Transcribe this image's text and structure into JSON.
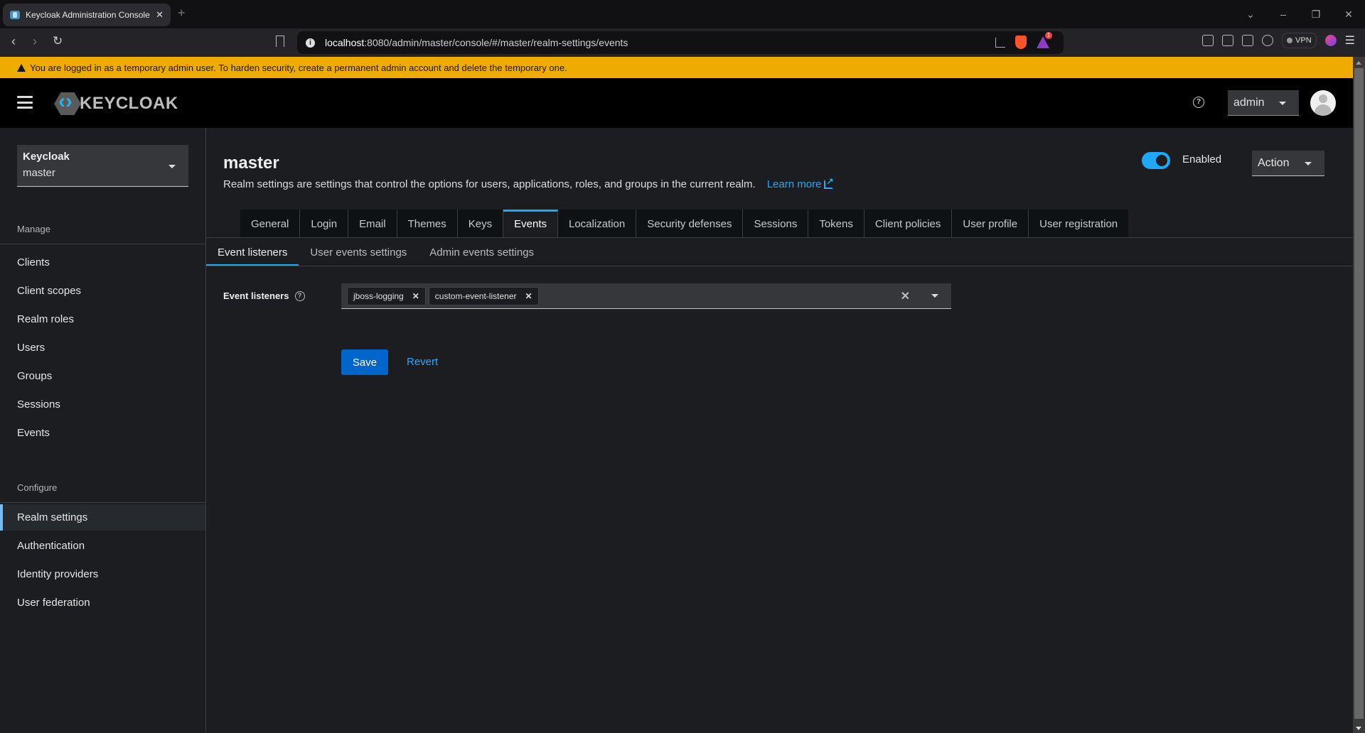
{
  "browser": {
    "tab_title": "Keycloak Administration Console",
    "tab_close": "✕",
    "new_tab": "+",
    "window_controls": [
      "⌄",
      "–",
      "❐",
      "✕"
    ],
    "url_host": "localhost",
    "url_path": ":8080/admin/master/console/#/master/realm-settings/events",
    "rewards_badge": "1",
    "vpn_label": "VPN",
    "nav_back": "‹",
    "nav_forward": "›",
    "nav_reload": "↻",
    "menu": "☰"
  },
  "banner": {
    "text": "You are logged in as a temporary admin user. To harden security, create a permanent admin account and delete the temporary one.",
    "color": "#f0ab00"
  },
  "masthead": {
    "logo_text": "KEYCLOAK",
    "help": "?",
    "user": "admin"
  },
  "sidebar": {
    "realm_selector": {
      "name": "Keycloak",
      "value": "master"
    },
    "sections": [
      {
        "title": "Manage",
        "items": [
          {
            "label": "Clients"
          },
          {
            "label": "Client scopes"
          },
          {
            "label": "Realm roles"
          },
          {
            "label": "Users"
          },
          {
            "label": "Groups"
          },
          {
            "label": "Sessions"
          },
          {
            "label": "Events"
          }
        ]
      },
      {
        "title": "Configure",
        "items": [
          {
            "label": "Realm settings",
            "active": true
          },
          {
            "label": "Authentication"
          },
          {
            "label": "Identity providers"
          },
          {
            "label": "User federation"
          }
        ]
      }
    ]
  },
  "header": {
    "title": "master",
    "description": "Realm settings are settings that control the options for users, applications, roles, and groups in the current realm.",
    "learn_more": "Learn more",
    "enabled_label": "Enabled",
    "enabled": true,
    "action_label": "Action"
  },
  "tabs": [
    {
      "label": "General"
    },
    {
      "label": "Login"
    },
    {
      "label": "Email"
    },
    {
      "label": "Themes"
    },
    {
      "label": "Keys"
    },
    {
      "label": "Events",
      "active": true
    },
    {
      "label": "Localization"
    },
    {
      "label": "Security defenses"
    },
    {
      "label": "Sessions"
    },
    {
      "label": "Tokens"
    },
    {
      "label": "Client policies"
    },
    {
      "label": "User profile"
    },
    {
      "label": "User registration"
    }
  ],
  "subtabs": [
    {
      "label": "Event listeners",
      "active": true
    },
    {
      "label": "User events settings"
    },
    {
      "label": "Admin events settings"
    }
  ],
  "form": {
    "event_listeners_label": "Event listeners",
    "help": "?",
    "chips": [
      {
        "label": "jboss-logging"
      },
      {
        "label": "custom-event-listener"
      }
    ],
    "chip_remove": "✕",
    "clear_all": "✕",
    "save_label": "Save",
    "revert_label": "Revert"
  },
  "colors": {
    "accent": "#1fa7f8",
    "primary_button": "#0066cc",
    "link": "#2ea6f4",
    "background": "#1b1d21"
  }
}
